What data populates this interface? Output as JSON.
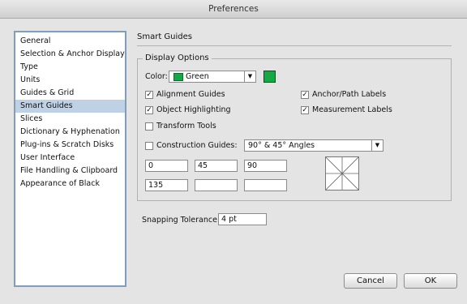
{
  "window": {
    "title": "Preferences"
  },
  "sidebar": {
    "items": [
      {
        "label": "General",
        "selected": false
      },
      {
        "label": "Selection & Anchor Display",
        "selected": false
      },
      {
        "label": "Type",
        "selected": false
      },
      {
        "label": "Units",
        "selected": false
      },
      {
        "label": "Guides & Grid",
        "selected": false
      },
      {
        "label": "Smart Guides",
        "selected": true
      },
      {
        "label": "Slices",
        "selected": false
      },
      {
        "label": "Dictionary & Hyphenation",
        "selected": false
      },
      {
        "label": "Plug-ins & Scratch Disks",
        "selected": false
      },
      {
        "label": "User Interface",
        "selected": false
      },
      {
        "label": "File Handling & Clipboard",
        "selected": false
      },
      {
        "label": "Appearance of Black",
        "selected": false
      }
    ]
  },
  "panel": {
    "title": "Smart Guides",
    "display_options": {
      "legend": "Display Options",
      "color_label": "Color:",
      "color_value": "Green",
      "color_hex": "#17a846",
      "alignment_guides": {
        "label": "Alignment Guides",
        "checked": true
      },
      "object_highlighting": {
        "label": "Object Highlighting",
        "checked": true
      },
      "transform_tools": {
        "label": "Transform Tools",
        "checked": false
      },
      "anchor_path_labels": {
        "label": "Anchor/Path Labels",
        "checked": true
      },
      "measurement_labels": {
        "label": "Measurement Labels",
        "checked": true
      },
      "construction_guides": {
        "label": "Construction Guides:",
        "checked": false,
        "selected_option": "90° & 45° Angles"
      },
      "angles": [
        "0",
        "45",
        "90",
        "135",
        "",
        ""
      ]
    },
    "snapping_tolerance": {
      "label": "Snapping Tolerance:",
      "value": "4 pt"
    }
  },
  "footer": {
    "cancel_label": "Cancel",
    "ok_label": "OK"
  }
}
